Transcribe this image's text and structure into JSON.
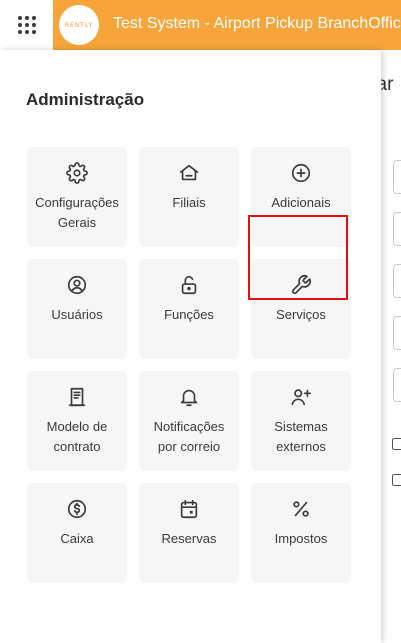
{
  "topbar": {
    "logo_text": "RENTLY",
    "title": "Test System - Airport Pickup BranchOffice",
    "accent_color": "#f7a53a"
  },
  "background": {
    "partial_title": "riar"
  },
  "drawer": {
    "title": "Administração",
    "tiles": [
      {
        "label": "Configurações Gerais",
        "icon": "gear-icon"
      },
      {
        "label": "Filiais",
        "icon": "home-icon"
      },
      {
        "label": "Adicionais",
        "icon": "plus-circle-icon"
      },
      {
        "label": "Usuários",
        "icon": "user-circle-icon"
      },
      {
        "label": "Funções",
        "icon": "unlock-icon"
      },
      {
        "label": "Serviços",
        "icon": "wrench-icon"
      },
      {
        "label": "Modelo de contrato",
        "icon": "contract-icon"
      },
      {
        "label": "Notificações por correio",
        "icon": "bell-icon"
      },
      {
        "label": "Sistemas externos",
        "icon": "users-plus-icon"
      },
      {
        "label": "Caixa",
        "icon": "dollar-circle-icon"
      },
      {
        "label": "Reservas",
        "icon": "calendar-icon"
      },
      {
        "label": "Impostos",
        "icon": "percent-icon"
      }
    ]
  }
}
